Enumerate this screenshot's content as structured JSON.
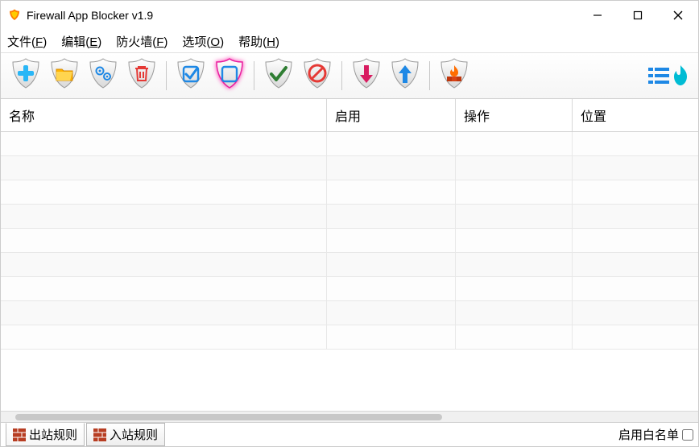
{
  "window": {
    "title": "Firewall App Blocker v1.9"
  },
  "menu": {
    "file": {
      "label": "文件",
      "acc": "F"
    },
    "edit": {
      "label": "编辑",
      "acc": "E"
    },
    "firewall": {
      "label": "防火墙",
      "acc": "F"
    },
    "options": {
      "label": "选项",
      "acc": "O"
    },
    "help": {
      "label": "帮助",
      "acc": "H"
    }
  },
  "toolbar": {
    "add": "add",
    "open_folder": "open-folder",
    "settings": "settings",
    "delete": "delete",
    "check_all": "check-all",
    "uncheck_all": "uncheck-all",
    "allow": "allow",
    "block": "block",
    "down": "down",
    "up": "up",
    "firewall_status": "firewall-status"
  },
  "columns": {
    "name": "名称",
    "enabled": "启用",
    "action": "操作",
    "location": "位置"
  },
  "rows": [
    {},
    {},
    {},
    {},
    {},
    {},
    {},
    {},
    {}
  ],
  "tabs": {
    "outbound": "出站规则",
    "inbound": "入站规则"
  },
  "status": {
    "whitelist_label": "启用白名单"
  }
}
